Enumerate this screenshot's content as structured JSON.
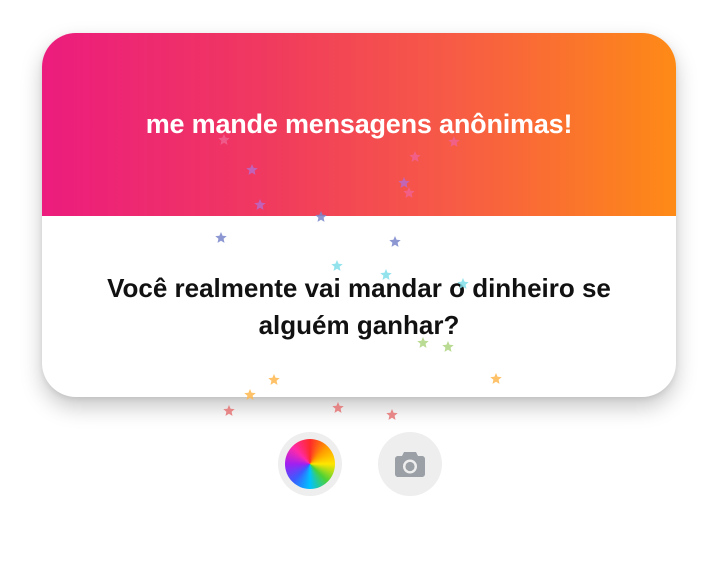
{
  "card": {
    "title": "me mande mensagens anônimas!",
    "question": "Você realmente vai mandar o dinheiro se alguém ganhar?",
    "gradient_start": "#ec1c7e",
    "gradient_end": "#fe8a16"
  },
  "toolbar": {
    "color_button_icon": "color-wheel-icon",
    "camera_button_icon": "camera-icon"
  },
  "confetti": {
    "icon": "star-icon",
    "colors": [
      "#f06292",
      "#ba68c8",
      "#7986cb",
      "#80deea",
      "#aed581",
      "#ffd54f",
      "#ffb74d",
      "#e57373"
    ]
  }
}
